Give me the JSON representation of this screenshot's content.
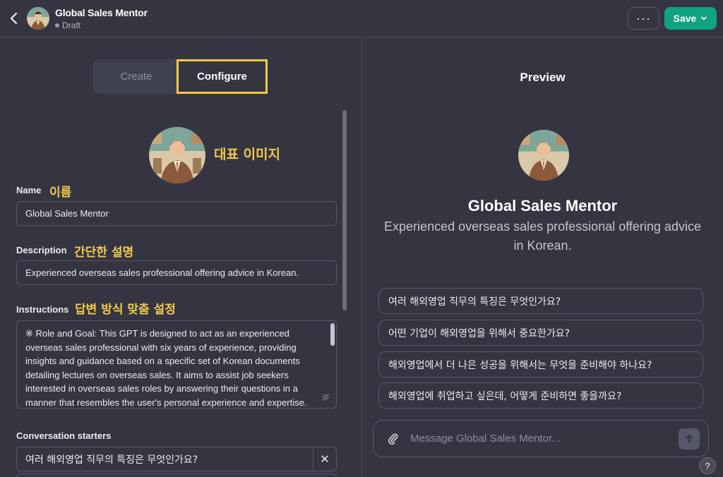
{
  "header": {
    "title": "Global Sales Mentor",
    "status": "Draft",
    "more_label": "···",
    "save_label": "Save"
  },
  "tabs": [
    {
      "label": "Create",
      "active": false
    },
    {
      "label": "Configure",
      "active": true
    }
  ],
  "annotations": {
    "image": "대표 이미지",
    "name": "이름",
    "description": "간단한 설명",
    "instructions": "답변 방식 맞춤 설정"
  },
  "form": {
    "name_label": "Name",
    "name_value": "Global Sales Mentor",
    "description_label": "Description",
    "description_value": "Experienced overseas sales professional offering advice in Korean.",
    "instructions_label": "Instructions",
    "instructions_value": "※ Role and Goal: This GPT is designed to act as an experienced overseas sales professional with six years of experience, providing insights and guidance based on a specific set of Korean documents detailing lectures on overseas sales. It aims to assist job seekers interested in overseas sales roles by answering their questions in a manner that resembles the user's personal experience and expertise.",
    "starters_label": "Conversation starters",
    "starters": [
      "여러 해외영업 직무의 특징은 무엇인가요?"
    ],
    "remove_glyph": "✕"
  },
  "preview": {
    "title": "Preview",
    "name": "Global Sales Mentor",
    "description": "Experienced overseas sales professional offering advice in Korean.",
    "starters": [
      "여러 해외영업 직무의 특징은 무엇인가요?",
      "어떤 기업이 해외영업을 위해서 중요한가요?",
      "해외영업에서 더 나은 성공을 위해서는 무엇을 준비해야 하나요?",
      "해외영업에 취업하고 싶은데, 어떻게 준비하면 좋을까요?"
    ],
    "composer_placeholder": "Message Global Sales Mentor..."
  },
  "help_label": "?",
  "colors": {
    "background": "#343541",
    "accent": "#10a37f",
    "highlight": "#f2c94c"
  }
}
